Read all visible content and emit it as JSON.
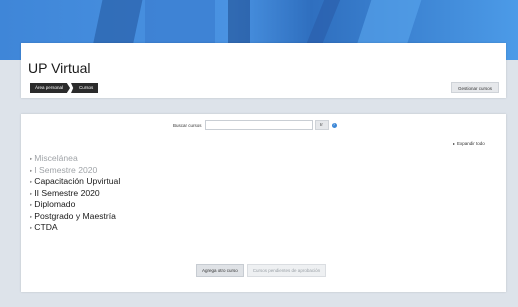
{
  "header": {
    "title": "UP Virtual",
    "breadcrumb": [
      "Área personal",
      "Cursos"
    ],
    "manage_button": "Gestionar cursos"
  },
  "search": {
    "label": "Buscar cursos",
    "value": "",
    "go_button": "Ir",
    "help_icon": "help-icon"
  },
  "expand_all": "Expandir todo",
  "courses": [
    {
      "label": "Miscelánea",
      "dimmed": true
    },
    {
      "label": "I Semestre 2020",
      "dimmed": true
    },
    {
      "label": "Capacitación Upvirtual",
      "dimmed": false
    },
    {
      "label": "II Semestre 2020",
      "dimmed": false
    },
    {
      "label": "Diplomado",
      "dimmed": false
    },
    {
      "label": "Postgrado y Maestría",
      "dimmed": false
    },
    {
      "label": "CTDA",
      "dimmed": false
    }
  ],
  "actions": {
    "add_course": "Agrega otro curso",
    "pending_courses": "Cursos pendientes de aprobación"
  },
  "colors": {
    "banner": "#3f86d8",
    "breadcrumb_bg": "#2b2b2b",
    "dimmed_text": "#a0a4a8"
  }
}
